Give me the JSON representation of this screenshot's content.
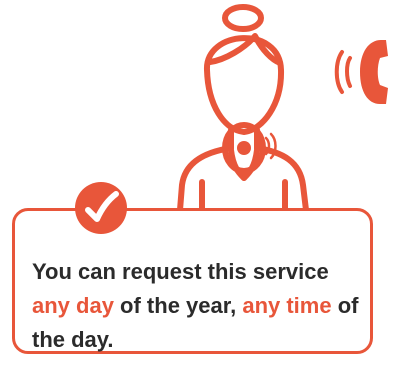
{
  "colors": {
    "accent": "#e8563a",
    "text": "#2b2b2b",
    "background": "#ffffff"
  },
  "icons": {
    "person": "operator-person-icon",
    "pendant": "alarm-pendant-icon",
    "phone": "ringing-phone-icon",
    "check": "checkmark-icon"
  },
  "message": {
    "part1": "You can request this service ",
    "highlight1": "any day",
    "part2": " of the year, ",
    "highlight2": "any time",
    "part3": " of the day."
  }
}
